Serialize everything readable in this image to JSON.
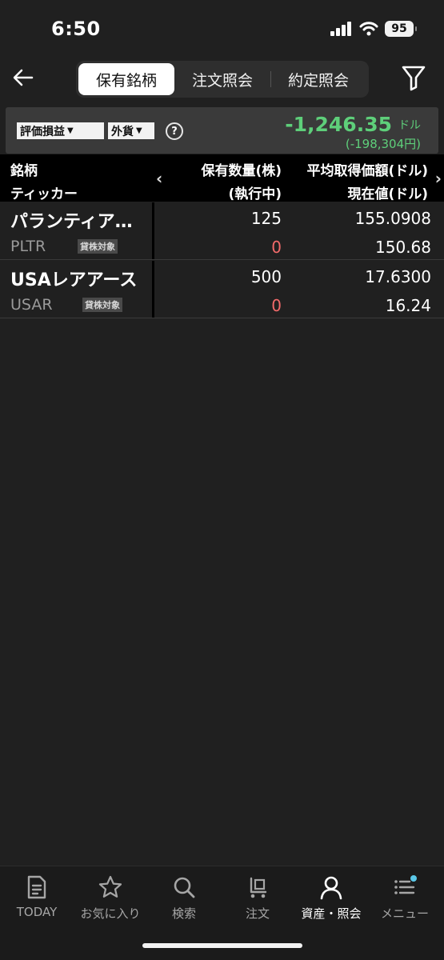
{
  "status": {
    "time": "6:50",
    "battery": "95"
  },
  "nav": {
    "tabs": [
      {
        "label": "保有銘柄",
        "active": true
      },
      {
        "label": "注文照会",
        "active": false
      },
      {
        "label": "約定照会",
        "active": false
      }
    ]
  },
  "summary": {
    "dropdown1": "評価損益",
    "dropdown2": "外貨",
    "help": "?",
    "pl_value": "-1,246.35",
    "pl_unit": "ドル",
    "pl_yen": "(-198,304円)"
  },
  "table_header": {
    "col1_line1": "銘柄",
    "col1_line2": "ティッカー",
    "col2_line1": "保有数量(株)",
    "col2_line2": "(執行中)",
    "col3_line1": "平均取得価額(ドル)",
    "col3_line2": "現在値(ドル)"
  },
  "holdings": [
    {
      "name": "パランティア…",
      "ticker": "PLTR",
      "badge": "貸株対象",
      "quantity": "125",
      "executing": "0",
      "avg_price": "155.0908",
      "current_price": "150.68"
    },
    {
      "name": "USAレアアース",
      "ticker": "USAR",
      "badge": "貸株対象",
      "quantity": "500",
      "executing": "0",
      "avg_price": "17.6300",
      "current_price": "16.24"
    }
  ],
  "tabbar": [
    {
      "label": "TODAY",
      "icon": "document-icon",
      "active": false
    },
    {
      "label": "お気に入り",
      "icon": "star-icon",
      "active": false
    },
    {
      "label": "検索",
      "icon": "search-icon",
      "active": false
    },
    {
      "label": "注文",
      "icon": "cart-icon",
      "active": false
    },
    {
      "label": "資産・照会",
      "icon": "person-icon",
      "active": true
    },
    {
      "label": "メニュー",
      "icon": "menu-icon",
      "active": false
    }
  ],
  "colors": {
    "gain_loss": "#5ecf7a",
    "executing": "#f26a6a",
    "notification_dot": "#5bc8e8"
  }
}
